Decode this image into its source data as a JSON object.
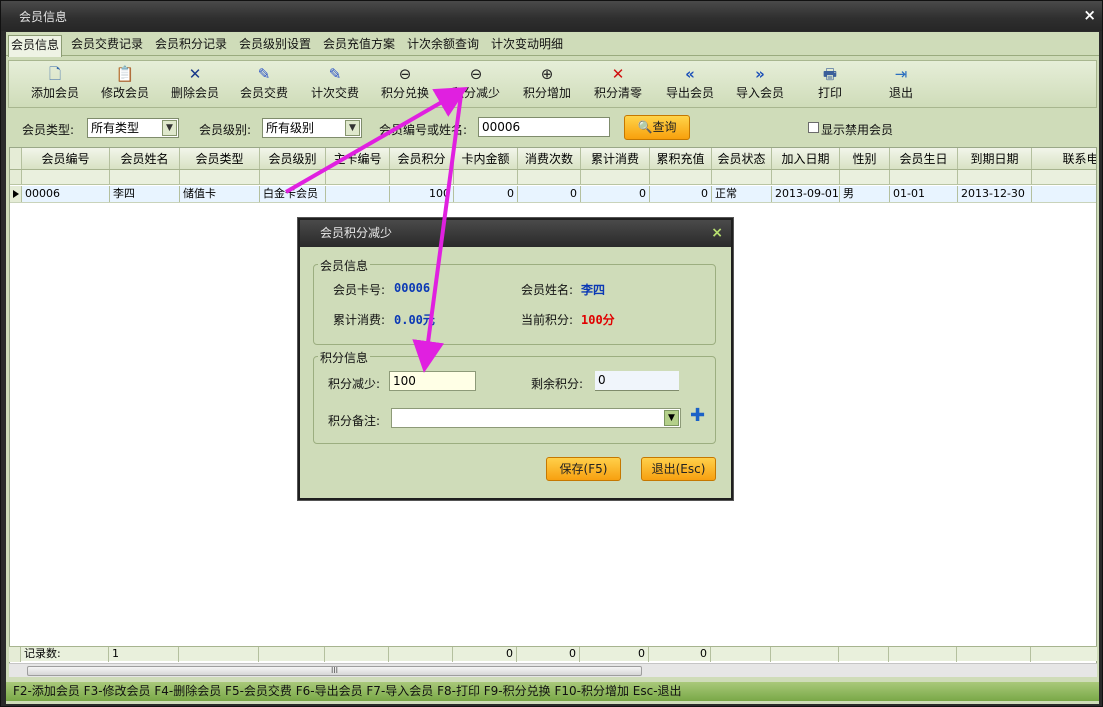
{
  "window": {
    "title": "会员信息",
    "close": "×"
  },
  "tabs": [
    {
      "label": "会员信息"
    },
    {
      "label": "会员交费记录"
    },
    {
      "label": "会员积分记录"
    },
    {
      "label": "会员级别设置"
    },
    {
      "label": "会员充值方案"
    },
    {
      "label": "计次余额查询"
    },
    {
      "label": "计次变动明细"
    }
  ],
  "toolbar": [
    {
      "label": "添加会员",
      "icon": "add-doc-icon",
      "glyph": "🗋"
    },
    {
      "label": "修改会员",
      "icon": "edit-doc-icon",
      "glyph": "📋"
    },
    {
      "label": "删除会员",
      "icon": "delete-icon",
      "glyph": "✕"
    },
    {
      "label": "会员交费",
      "icon": "pen-icon",
      "glyph": "✎"
    },
    {
      "label": "计次交费",
      "icon": "pen-icon",
      "glyph": "✎"
    },
    {
      "label": "积分兑换",
      "icon": "magnify-icon",
      "glyph": "⊖"
    },
    {
      "label": "积分减少",
      "icon": "zoom-out-icon",
      "glyph": "⊖"
    },
    {
      "label": "积分增加",
      "icon": "zoom-in-icon",
      "glyph": "⊕"
    },
    {
      "label": "积分清零",
      "icon": "clear-icon",
      "glyph": "✕"
    },
    {
      "label": "导出会员",
      "icon": "export-icon",
      "glyph": "«"
    },
    {
      "label": "导入会员",
      "icon": "import-icon",
      "glyph": "»"
    },
    {
      "label": "打印",
      "icon": "print-icon",
      "glyph": "🖶"
    },
    {
      "label": "退出",
      "icon": "exit-icon",
      "glyph": "⇥"
    }
  ],
  "filter": {
    "type_label": "会员类型:",
    "type_value": "所有类型",
    "level_label": "会员级别:",
    "level_value": "所有级别",
    "search_label": "会员编号或姓名:",
    "search_value": "00006",
    "query_button": "查询",
    "show_disabled": "显示禁用会员"
  },
  "grid": {
    "columns": [
      "会员编号",
      "会员姓名",
      "会员类型",
      "会员级别",
      "主卡编号",
      "会员积分",
      "卡内金额",
      "消费次数",
      "累计消费",
      "累积充值",
      "会员状态",
      "加入日期",
      "性别",
      "会员生日",
      "到期日期",
      "联系电话"
    ],
    "rows": [
      [
        "00006",
        "李四",
        "储值卡",
        "白金卡会员",
        "",
        "100",
        "0",
        "0",
        "0",
        "0",
        "正常",
        "2013-09-01",
        "男",
        "01-01",
        "2013-12-30",
        ""
      ]
    ],
    "footer_label": "记录数:",
    "footer_count": "1",
    "footer_zeros": [
      "0",
      "0",
      "0",
      "0"
    ],
    "scroll_grip": "III"
  },
  "statusbar": "F2-添加会员 F3-修改会员 F4-删除会员 F5-会员交费 F6-导出会员 F7-导入会员 F8-打印 F9-积分兑换 F10-积分增加 Esc-退出",
  "dialog": {
    "title": "会员积分减少",
    "close": "×",
    "info_group": "会员信息",
    "card_label": "会员卡号:",
    "card_value": "00006",
    "name_label": "会员姓名:",
    "name_value": "李四",
    "consume_label": "累计消费:",
    "consume_value": "0.00元",
    "points_label": "当前积分:",
    "points_value": "100分",
    "points_group": "积分信息",
    "reduce_label": "积分减少:",
    "reduce_value": "100",
    "remain_label": "剩余积分:",
    "remain_value": "0",
    "note_label": "积分备注:",
    "note_value": "",
    "save_button": "保存(F5)",
    "exit_button": "退出(Esc)"
  },
  "colors": {
    "panel": "#cfdcb9",
    "accent_orange": "#f8a00c",
    "annotation": "#e020e0",
    "status_green": "#79a847"
  }
}
